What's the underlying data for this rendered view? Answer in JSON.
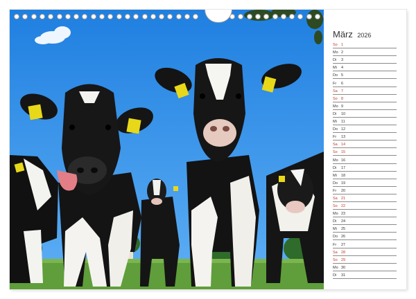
{
  "calendar": {
    "month": "März",
    "year": "2026",
    "days": [
      {
        "wd": "So",
        "d": "1",
        "we": true
      },
      {
        "wd": "Mo",
        "d": "2",
        "we": false
      },
      {
        "wd": "Di",
        "d": "3",
        "we": false
      },
      {
        "wd": "Mi",
        "d": "4",
        "we": false
      },
      {
        "wd": "Do",
        "d": "5",
        "we": false
      },
      {
        "wd": "Fr",
        "d": "6",
        "we": false
      },
      {
        "wd": "Sa",
        "d": "7",
        "we": true
      },
      {
        "wd": "So",
        "d": "8",
        "we": true
      },
      {
        "wd": "Mo",
        "d": "9",
        "we": false
      },
      {
        "wd": "Di",
        "d": "10",
        "we": false
      },
      {
        "wd": "Mi",
        "d": "11",
        "we": false
      },
      {
        "wd": "Do",
        "d": "12",
        "we": false
      },
      {
        "wd": "Fr",
        "d": "13",
        "we": false
      },
      {
        "wd": "Sa",
        "d": "14",
        "we": true
      },
      {
        "wd": "So",
        "d": "15",
        "we": true
      },
      {
        "wd": "Mo",
        "d": "16",
        "we": false
      },
      {
        "wd": "Di",
        "d": "17",
        "we": false
      },
      {
        "wd": "Mi",
        "d": "18",
        "we": false
      },
      {
        "wd": "Do",
        "d": "19",
        "we": false
      },
      {
        "wd": "Fr",
        "d": "20",
        "we": false
      },
      {
        "wd": "Sa",
        "d": "21",
        "we": true
      },
      {
        "wd": "So",
        "d": "22",
        "we": true
      },
      {
        "wd": "Mo",
        "d": "23",
        "we": false
      },
      {
        "wd": "Di",
        "d": "24",
        "we": false
      },
      {
        "wd": "Mi",
        "d": "25",
        "we": false
      },
      {
        "wd": "Do",
        "d": "26",
        "we": false
      },
      {
        "wd": "Fr",
        "d": "27",
        "we": false
      },
      {
        "wd": "Sa",
        "d": "28",
        "we": true
      },
      {
        "wd": "So",
        "d": "29",
        "we": true
      },
      {
        "wd": "Mo",
        "d": "30",
        "we": false
      },
      {
        "wd": "Di",
        "d": "31",
        "we": false
      }
    ]
  },
  "colors": {
    "sky": "#2f8be6",
    "grass": "#5f9e3a",
    "weekend": "#c0392b",
    "text": "#333333"
  },
  "photo": {
    "subject": "holstein-cows-photo"
  }
}
